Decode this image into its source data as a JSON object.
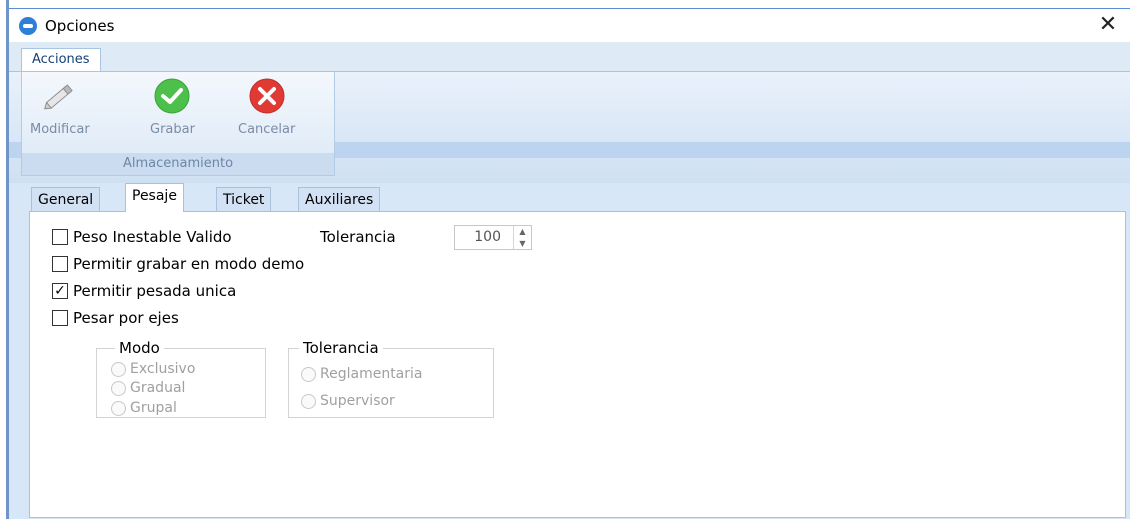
{
  "window": {
    "title": "Opciones",
    "close_glyph": "✕"
  },
  "ribbon": {
    "tab": "Acciones",
    "group_label": "Almacenamiento",
    "buttons": {
      "modify": "Modificar",
      "save": "Grabar",
      "cancel": "Cancelar"
    }
  },
  "tabs": [
    "General",
    "Pesaje",
    "Ticket",
    "Auxiliares"
  ],
  "active_tab": "Pesaje",
  "pesaje": {
    "peso_inestable": {
      "label": "Peso Inestable Valido",
      "checked": false
    },
    "tolerancia_label": "Tolerancia",
    "tolerancia_value": "100",
    "modo_demo": {
      "label": "Permitir grabar en modo demo",
      "checked": false
    },
    "pesada_unica": {
      "label": "Permitir pesada unica",
      "checked": true,
      "check_glyph": "✓"
    },
    "pesar_ejes": {
      "label": "Pesar por ejes",
      "checked": false
    },
    "modo_group": {
      "legend": "Modo",
      "options": [
        "Exclusivo",
        "Gradual",
        "Grupal"
      ]
    },
    "tolerancia_group": {
      "legend": "Tolerancia",
      "options": [
        "Reglamentaria",
        "Supervisor"
      ]
    }
  },
  "colors": {
    "ribbon_accent": "#dfeaf7",
    "save_green": "#4cc04a",
    "cancel_red": "#e03a35"
  },
  "icons": [
    "app-icon",
    "pencil-icon",
    "check-icon",
    "x-icon",
    "up-arrow-icon",
    "down-arrow-icon"
  ]
}
